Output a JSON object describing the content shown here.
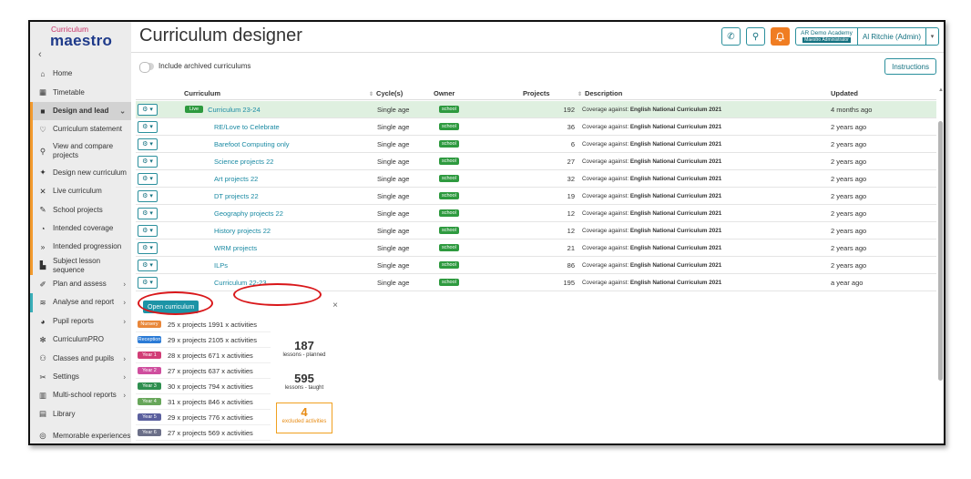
{
  "brand": {
    "top": "Curriculum",
    "main": "maestro"
  },
  "sidebar": {
    "collapse_icon": "chevron-left-icon",
    "items": [
      {
        "label": "Home",
        "icon": "⌂",
        "icon_name": "home-icon"
      },
      {
        "label": "Timetable",
        "icon": "▦",
        "icon_name": "timetable-icon"
      },
      {
        "label": "Design and lead",
        "icon": "■",
        "icon_name": "design-icon",
        "chevron": "⌄"
      },
      {
        "label": "Curriculum statement",
        "icon": "♡",
        "icon_name": "heart-icon"
      },
      {
        "label": "View and compare projects",
        "icon": "⚲",
        "icon_name": "search-icon"
      },
      {
        "label": "Design new curriculum",
        "icon": "✦",
        "icon_name": "design-new-icon"
      },
      {
        "label": "Live curriculum",
        "icon": "✕",
        "icon_name": "live-icon"
      },
      {
        "label": "School projects",
        "icon": "✎",
        "icon_name": "edit-icon"
      },
      {
        "label": "Intended coverage",
        "icon": "◔",
        "icon_name": "coverage-icon"
      },
      {
        "label": "Intended progression",
        "icon": "»",
        "icon_name": "progression-icon"
      },
      {
        "label": "Subject lesson sequence",
        "icon": "▙",
        "icon_name": "sequence-icon"
      },
      {
        "label": "Plan and assess",
        "icon": "✐",
        "icon_name": "plan-icon",
        "chevron": "›"
      },
      {
        "label": "Analyse and report",
        "icon": "≋",
        "icon_name": "analyse-icon",
        "chevron": "›"
      },
      {
        "label": "Pupil reports",
        "icon": "◕",
        "icon_name": "pupil-reports-icon",
        "chevron": "›"
      },
      {
        "label": "CurriculumPRO",
        "icon": "✻",
        "icon_name": "curriculumpro-icon"
      },
      {
        "label": "Classes and pupils",
        "icon": "⚇",
        "icon_name": "classes-icon",
        "chevron": "›"
      },
      {
        "label": "Settings",
        "icon": "✂",
        "icon_name": "settings-icon",
        "chevron": "›"
      },
      {
        "label": "Multi-school reports",
        "icon": "▥",
        "icon_name": "multi-school-icon",
        "chevron": "›"
      },
      {
        "label": "Library",
        "icon": "▤",
        "icon_name": "library-icon"
      },
      {
        "label": "Memorable experiences",
        "icon": "◎",
        "icon_name": "memorable-icon"
      }
    ]
  },
  "header": {
    "title": "Curriculum designer",
    "phone_icon": "✆",
    "search_icon": "⚲",
    "bell_icon": "🔔",
    "school_name": "AR Demo Academy",
    "role": "Maestro Administrator",
    "user": "Al Ritchie (Admin)",
    "dropdown_icon": "▾"
  },
  "toolbar": {
    "archive_label": "Include archived curriculums",
    "instructions_label": "Instructions"
  },
  "table": {
    "columns": {
      "curriculum": "Curriculum",
      "cycles": "Cycle(s)",
      "owner": "Owner",
      "projects": "Projects",
      "description": "Description",
      "updated": "Updated"
    },
    "sort_icon": "⇕",
    "gear_label": "⚙ ▾",
    "rows": [
      {
        "name": "Curriculum 23-24",
        "live": "Live",
        "cycles": "Single age",
        "owner": "school",
        "projects": "192",
        "cov_prefix": "Coverage against:",
        "cov_bold": "English National Curriculum 2021",
        "updated": "4 months ago"
      },
      {
        "name": "RE/Love to Celebrate",
        "cycles": "Single age",
        "owner": "school",
        "projects": "36",
        "cov_prefix": "Coverage against:",
        "cov_bold": "English National Curriculum 2021",
        "updated": "2 years ago"
      },
      {
        "name": "Barefoot Computing only",
        "cycles": "Single age",
        "owner": "school",
        "projects": "6",
        "cov_prefix": "Coverage against:",
        "cov_bold": "English National Curriculum 2021",
        "updated": "2 years ago"
      },
      {
        "name": "Science projects 22",
        "cycles": "Single age",
        "owner": "school",
        "projects": "27",
        "cov_prefix": "Coverage against:",
        "cov_bold": "English National Curriculum 2021",
        "updated": "2 years ago"
      },
      {
        "name": "Art projects 22",
        "cycles": "Single age",
        "owner": "school",
        "projects": "32",
        "cov_prefix": "Coverage against:",
        "cov_bold": "English National Curriculum 2021",
        "updated": "2 years ago"
      },
      {
        "name": "DT projects 22",
        "cycles": "Single age",
        "owner": "school",
        "projects": "19",
        "cov_prefix": "Coverage against:",
        "cov_bold": "English National Curriculum 2021",
        "updated": "2 years ago"
      },
      {
        "name": "Geography projects 22",
        "cycles": "Single age",
        "owner": "school",
        "projects": "12",
        "cov_prefix": "Coverage against:",
        "cov_bold": "English National Curriculum 2021",
        "updated": "2 years ago"
      },
      {
        "name": "History projects 22",
        "cycles": "Single age",
        "owner": "school",
        "projects": "12",
        "cov_prefix": "Coverage against:",
        "cov_bold": "English National Curriculum 2021",
        "updated": "2 years ago"
      },
      {
        "name": "WRM projects",
        "cycles": "Single age",
        "owner": "school",
        "projects": "21",
        "cov_prefix": "Coverage against:",
        "cov_bold": "English National Curriculum 2021",
        "updated": "2 years ago"
      },
      {
        "name": "ILPs",
        "cycles": "Single age",
        "owner": "school",
        "projects": "86",
        "cov_prefix": "Coverage against:",
        "cov_bold": "English National Curriculum 2021",
        "updated": "2 years ago"
      },
      {
        "name": "Curriculum 22-23",
        "cycles": "Single age",
        "owner": "school",
        "projects": "195",
        "cov_prefix": "Coverage against:",
        "cov_bold": "English National Curriculum 2021",
        "updated": "a year ago"
      }
    ]
  },
  "popup": {
    "open_label": "Open curriculum",
    "close_icon": "×",
    "years": [
      {
        "badge": "Nursery",
        "color": "#e8873a",
        "text": "25 x projects  1991 x activities"
      },
      {
        "badge": "Reception",
        "color": "#2b7bd6",
        "text": "29 x projects  2105 x activities"
      },
      {
        "badge": "Year 1",
        "color": "#d13d76",
        "text": "28 x projects  671 x activities"
      },
      {
        "badge": "Year 2",
        "color": "#cf4e9e",
        "text": "27 x projects  637 x activities"
      },
      {
        "badge": "Year 3",
        "color": "#2e8f4f",
        "text": "30 x projects  794 x activities"
      },
      {
        "badge": "Year 4",
        "color": "#67a65a",
        "text": "31 x projects  846 x activities"
      },
      {
        "badge": "Year 5",
        "color": "#5a5f9e",
        "text": "29 x projects  776 x activities"
      },
      {
        "badge": "Year 6",
        "color": "#6b6f88",
        "text": "27 x projects  569 x activities"
      }
    ],
    "planned": {
      "value": "187",
      "label": "lessons - planned"
    },
    "taught": {
      "value": "595",
      "label": "lessons - taught"
    },
    "excluded": {
      "value": "4",
      "label": "excluded activities"
    }
  },
  "colors": {
    "accent": "#137180",
    "link": "#1a8aa3",
    "live": "#2e9a3f",
    "alert": "#f07d22",
    "highlight": "#d9171a"
  }
}
